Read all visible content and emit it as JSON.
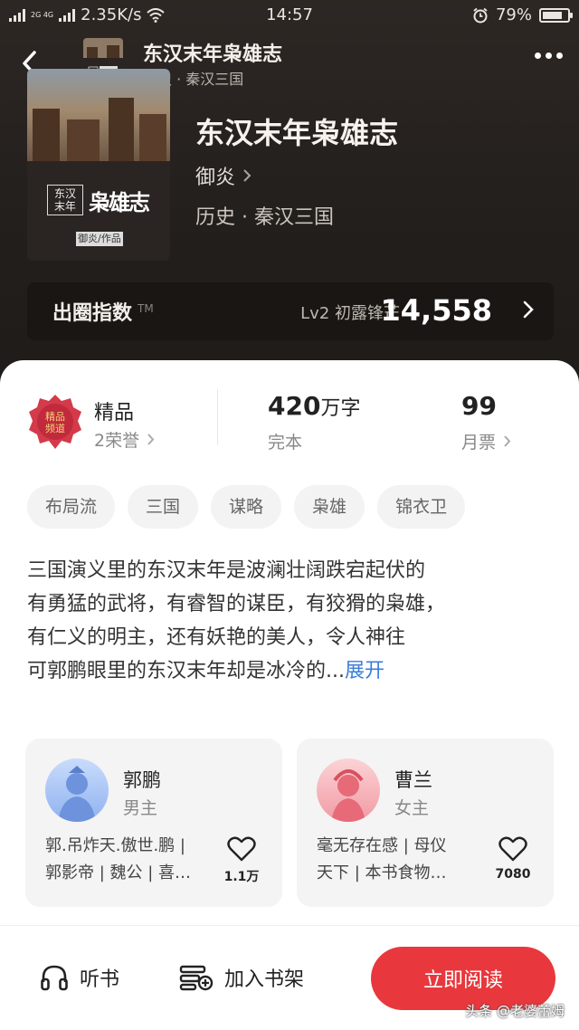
{
  "status_bar": {
    "network_small": "2G 4G",
    "speed": "2.35K/s",
    "time": "14:57",
    "battery": "79%",
    "battery_level": 0.79
  },
  "nav": {
    "title": "东汉末年枭雄志",
    "subtitle": "历史 · 秦汉三国"
  },
  "book": {
    "title": "东汉末年枭雄志",
    "author": "御炎",
    "category": "历史 · 秦汉三国",
    "cover": {
      "small_title": "东汉末年",
      "big_title": "枭雄志",
      "author_tag": "御炎/作品"
    }
  },
  "heat": {
    "label": "出圈指数",
    "tm": "TM",
    "level": "Lv2 初露锋芒",
    "score": "14,558"
  },
  "stats": {
    "quality": "精品",
    "honor": "2荣誉",
    "badge_text": "精品频道",
    "word_count_num": "420",
    "word_count_unit": "万字",
    "status": "完本",
    "tickets": "99",
    "tickets_label": "月票"
  },
  "tags": [
    "布局流",
    "三国",
    "谋略",
    "枭雄",
    "锦衣卫"
  ],
  "description": {
    "lines": [
      "三国演义里的东汉末年是波澜壮阔跌宕起伏的",
      "有勇猛的武将，有睿智的谋臣，有狡猾的枭雄，",
      "有仁义的明主，还有妖艳的美人，令人神往",
      "可郭鹏眼里的东汉末年却是冰冷的..."
    ],
    "expand": "展开"
  },
  "characters": [
    {
      "name": "郭鹏",
      "role": "男主",
      "alias_line1": "郭.吊炸天.傲世.鹏 |",
      "alias_line2": "郭影帝 | 魏公 | 喜…",
      "likes": "1.1万"
    },
    {
      "name": "曹兰",
      "role": "女主",
      "alias_line1": "毫无存在感 | 母仪",
      "alias_line2": "天下 | 本书食物…",
      "likes": "7080"
    }
  ],
  "bottom": {
    "listen": "听书",
    "shelf": "加入书架",
    "read": "立即阅读",
    "watermark": "头条 @老婆蕾姆"
  },
  "colors": {
    "accent": "#e8383d",
    "link": "#3b7ed6",
    "header_bg": "#2d2724"
  }
}
